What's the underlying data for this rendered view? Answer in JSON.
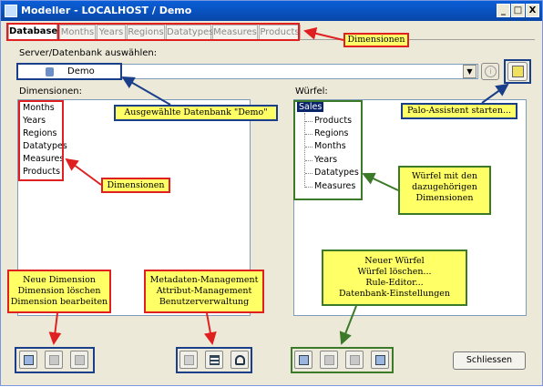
{
  "window": {
    "title": "Modeller - LOCALHOST / Demo",
    "minimize": "_",
    "maximize": "□",
    "close": "X"
  },
  "tabs": [
    {
      "label": "Database"
    },
    {
      "label": "Months"
    },
    {
      "label": "Years"
    },
    {
      "label": "Regions"
    },
    {
      "label": "Datatypes"
    },
    {
      "label": "Measures"
    },
    {
      "label": "Products"
    }
  ],
  "server_label": "Server/Datenbank auswählen:",
  "database": {
    "selected": "Demo"
  },
  "dimensions_label": "Dimensionen:",
  "cubes_label": "Würfel:",
  "dimensions": [
    "Months",
    "Years",
    "Regions",
    "Datatypes",
    "Measures",
    "Products"
  ],
  "cube": {
    "name": "Sales",
    "dimensions": [
      "Products",
      "Regions",
      "Months",
      "Years",
      "Datatypes",
      "Measures"
    ]
  },
  "close_button": "Schliessen",
  "callouts": {
    "tabs": "Dimensionen",
    "selected_db": "Ausgewählte Datenbank \"Demo\"",
    "wizard": "Palo-Assistent starten...",
    "dims_list": "Dimensionen",
    "cube_dims": [
      "Würfel mit den",
      "dazugehörigen",
      "Dimensionen"
    ],
    "dim_buttons": [
      "Neue Dimension",
      "Dimension löschen",
      "Dimension bearbeiten"
    ],
    "meta_buttons": [
      "Metadaten-Management",
      "Attribut-Management",
      "Benutzerverwaltung"
    ],
    "cube_buttons": [
      "Neuer Würfel",
      "Würfel löschen...",
      "Rule-Editor...",
      "Datenbank-Einstellungen"
    ]
  },
  "colors": {
    "annotation_red": "#e02020",
    "annotation_blue": "#1a3f8a",
    "annotation_green": "#3a7a28",
    "callout_yellow": "#ffff66",
    "titlebar": "#0a5fd8"
  }
}
